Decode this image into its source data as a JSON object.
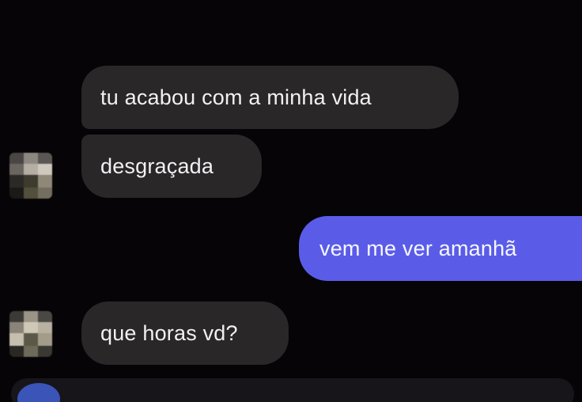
{
  "messages": [
    {
      "direction": "incoming",
      "text": "tu acabou com a minha vida"
    },
    {
      "direction": "incoming",
      "text": "desgraçada"
    },
    {
      "direction": "outgoing",
      "text": "vem me ver amanhã"
    },
    {
      "direction": "incoming",
      "text": "que horas vd?"
    }
  ],
  "avatar": {
    "state": "pixelated"
  },
  "colors": {
    "background": "#060407",
    "incoming_bubble": "#2a2729",
    "outgoing_bubble": "#5a5ce8",
    "text": "#f2f0f2"
  }
}
